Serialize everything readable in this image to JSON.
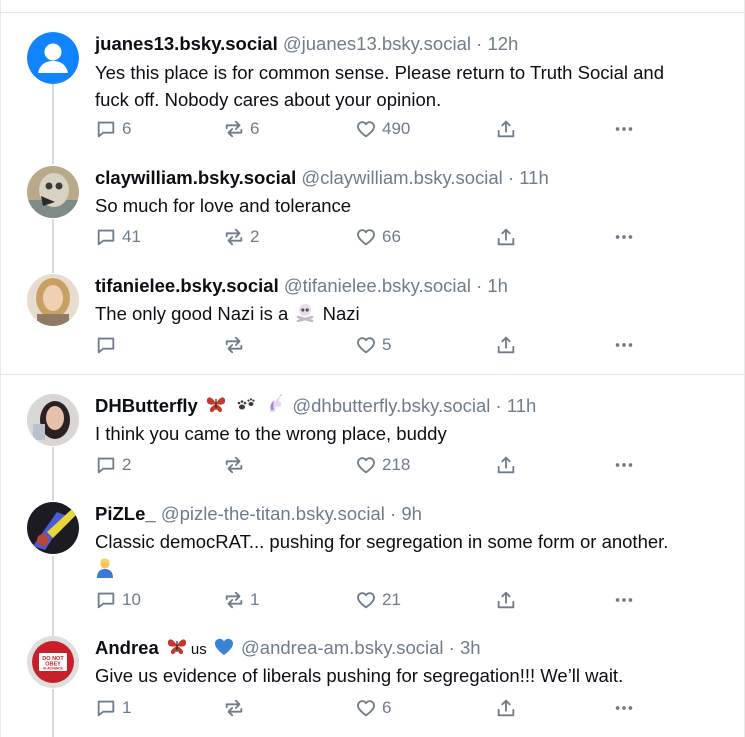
{
  "posts": [
    {
      "display_name": "juanes13.bsky.social",
      "handle": "@juanes13.bsky.social",
      "separator": "·",
      "time": "12h",
      "lines": [
        "Yes this place is for common sense.  Please return to Truth Social and",
        "fuck off.  Nobody cares about your opinion."
      ],
      "replies": "6",
      "reposts": "6",
      "likes": "490",
      "avatar_icon": "default-avatar-icon",
      "avatar_color": "#1083fe"
    },
    {
      "display_name": "claywilliam.bsky.social",
      "handle": "@claywilliam.bsky.social",
      "separator": "·",
      "time": "11h",
      "lines": [
        "So much for love and tolerance"
      ],
      "replies": "41",
      "reposts": "2",
      "likes": "66"
    },
    {
      "display_name": "tifanielee.bsky.social",
      "handle": "@tifanielee.bsky.social",
      "separator": "·",
      "time": "1h",
      "text_before": "The only good Nazi is a",
      "text_emoji": "skull-and-crossbones-emoji",
      "text_after": "Nazi",
      "replies": "",
      "reposts": "",
      "likes": "5"
    },
    {
      "display_name": "DHButterfly",
      "name_emojis": [
        "butterfly-emoji",
        "paw-prints-emoji",
        "unicorn-emoji"
      ],
      "handle": "@dhbutterfly.bsky.social",
      "separator": "·",
      "time": "11h",
      "lines": [
        "I think you came to the wrong place, buddy"
      ],
      "replies": "2",
      "reposts": "",
      "likes": "218"
    },
    {
      "display_name": "PiZLe_",
      "handle": "@pizle-the-titan.bsky.social",
      "separator": "·",
      "time": "9h",
      "lines": [
        "Classic democRAT... pushing for segregation in some form or another."
      ],
      "line2_emoji": "person-shrugging-emoji",
      "replies": "10",
      "reposts": "1",
      "likes": "21"
    },
    {
      "display_name": "Andrea",
      "name_suffix": "us",
      "name_emojis": [
        "butterfly-emoji",
        "blue-heart-emoji"
      ],
      "handle": "@andrea-am.bsky.social",
      "separator": "·",
      "time": "3h",
      "lines": [
        "Give us evidence of liberals pushing for segregation!!! We’ll wait."
      ],
      "replies": "1",
      "reposts": "",
      "likes": "6",
      "avatar_sign_lines": [
        "DO NOT",
        "OBEY",
        "IN ADVANCE"
      ]
    }
  ],
  "icons": {
    "reply": "speech-bubble-icon",
    "repost": "repost-arrows-icon",
    "like": "heart-outline-icon",
    "share": "share-upload-icon",
    "more": "more-dots-icon"
  },
  "colors": {
    "text": "#0b0f14",
    "muted": "#6f7c8b",
    "thread_line": "#d4dbe2",
    "divider": "#e3e7ec"
  }
}
